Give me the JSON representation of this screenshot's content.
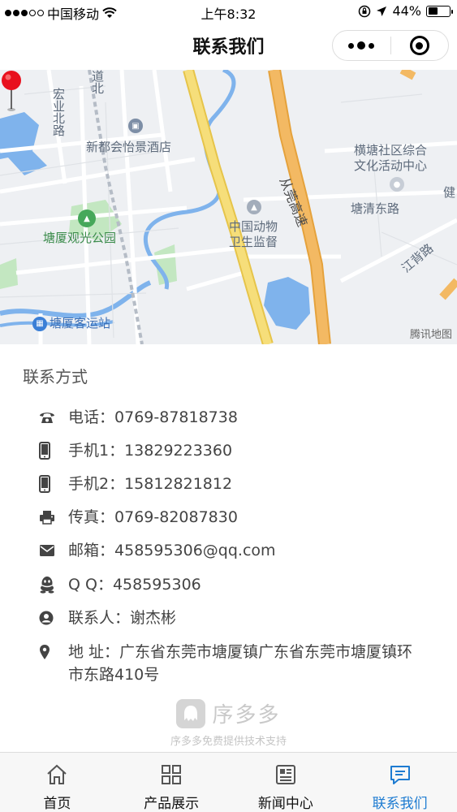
{
  "status_bar": {
    "carrier": "中国移动",
    "time": "上午8:32",
    "battery": "44%",
    "battery_level": 0.44
  },
  "nav": {
    "title": "联系我们",
    "more_icon": "more-dots-icon",
    "close_icon": "target-icon"
  },
  "map": {
    "labels": {
      "hongye": "宏业北路",
      "dao": "道北",
      "hotel": "新都会怡景酒店",
      "hengtang": "横塘社区综合",
      "hengtang2": "文化活动中心",
      "congguan": "从莞高速",
      "tangqing": "塘清东路",
      "jian": "健",
      "park": "塘厦观光公园",
      "animal": "中国动物",
      "animal2": "卫生监督",
      "jiangbei": "江背路",
      "station": "塘厦客运站"
    },
    "watermark": "腾讯地图"
  },
  "contact": {
    "title": "联系方式",
    "rows": [
      {
        "icon": "phone-icon",
        "label": "电话：",
        "value": "0769-87818738"
      },
      {
        "icon": "mobile-icon",
        "label": "手机1：",
        "value": "13829223360"
      },
      {
        "icon": "mobile-icon",
        "label": "手机2：",
        "value": "15812821812"
      },
      {
        "icon": "fax-icon",
        "label": "传真：",
        "value": "0769-82087830"
      },
      {
        "icon": "mail-icon",
        "label": "邮箱：",
        "value": "458595306@qq.com"
      },
      {
        "icon": "qq-icon",
        "label": "Q Q：",
        "value": "458595306"
      },
      {
        "icon": "person-icon",
        "label": "联系人：",
        "value": "谢杰彬"
      },
      {
        "icon": "location-icon",
        "label": "地 址：",
        "value": "广东省东莞市塘厦镇广东省东莞市塘厦镇环市东路410号"
      }
    ]
  },
  "footer": {
    "logo_text": "序多多",
    "note": "序多多免费提供技术支持"
  },
  "tabs": [
    {
      "icon": "home-icon",
      "label": "首页"
    },
    {
      "icon": "grid-icon",
      "label": "产品展示"
    },
    {
      "icon": "news-icon",
      "label": "新闻中心"
    },
    {
      "icon": "message-icon",
      "label": "联系我们"
    }
  ],
  "colors": {
    "accent": "#1d7bd1",
    "highway": "#f0b04a",
    "road_yellow": "#f5d76e",
    "water": "#6aa6e8",
    "park": "#b9e3b8"
  }
}
